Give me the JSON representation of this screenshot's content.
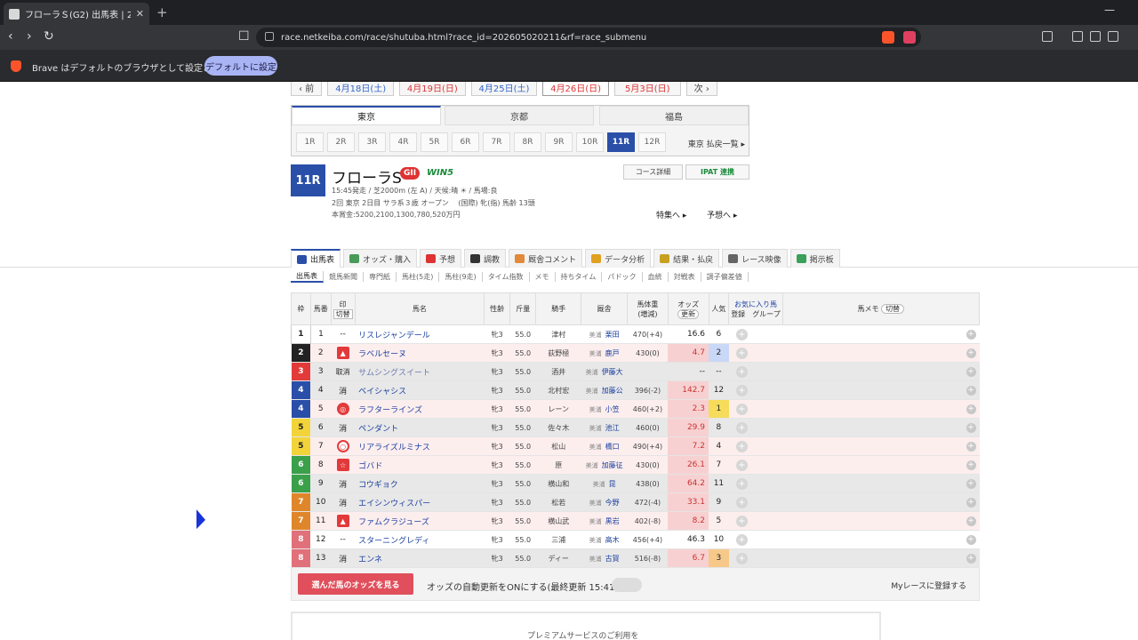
{
  "browser": {
    "tab_title": "フローラＳ(G2) 出馬表 | 2026年4月",
    "url": "race.netkeiba.com/race/shutuba.html?race_id=202605020211&rf=race_submenu",
    "infobar_message": "Brave はデフォルトのブラウザとして設定されていません",
    "infobar_button": "デフォルトに設定"
  },
  "dates": {
    "prev": "‹ 前",
    "next": "次 ›",
    "items": [
      {
        "label": "4月18日(土)",
        "kind": "sat"
      },
      {
        "label": "4月19日(日)",
        "kind": "sun"
      },
      {
        "label": "4月25日(土)",
        "kind": "sat"
      },
      {
        "label": "4月26日(日)",
        "kind": "sun",
        "active": true
      },
      {
        "label": "5月3日(日)",
        "kind": "sun"
      }
    ]
  },
  "venues": [
    "東京",
    "京都",
    "福島"
  ],
  "races": [
    "1R",
    "2R",
    "3R",
    "4R",
    "5R",
    "6R",
    "7R",
    "8R",
    "9R",
    "10R",
    "11R",
    "12R"
  ],
  "race_list_link": "東京 払戻一覧 ▸",
  "race": {
    "number": "11R",
    "name": "フローラS",
    "grade": "GII",
    "win5": "WIN5",
    "line1": "15:45発走 / 芝2000m (左 A) / 天候:晴 ☀ / 馬場:良",
    "line2": "2回 東京 2日目 サラ系３歳 オープン 　(国際) 牝(指) 馬齢 13頭",
    "line3": "本賞金:5200,2100,1300,780,520万円",
    "course_btn": "コース詳細",
    "ipat_btn": "IPAT 連携",
    "tokushu": "特集へ ▸",
    "yoso": "予想へ ▸"
  },
  "main_tabs": [
    {
      "label": "出馬表",
      "color": "#2a4fa8",
      "active": true
    },
    {
      "label": "オッズ・購入",
      "color": "#4a9a5a"
    },
    {
      "label": "予想",
      "color": "#d33"
    },
    {
      "label": "調教",
      "color": "#333"
    },
    {
      "label": "厩舎コメント",
      "color": "#e08a3a"
    },
    {
      "label": "データ分析",
      "color": "#e0a020"
    },
    {
      "label": "結果・払戻",
      "color": "#c8a020"
    },
    {
      "label": "レース映像",
      "color": "#666"
    },
    {
      "label": "掲示板",
      "color": "#3aa05a"
    }
  ],
  "sub_nav": [
    "出馬表",
    "競馬新聞",
    "専門紙",
    "馬柱(5走)",
    "馬柱(9走)",
    "タイム指数",
    "メモ",
    "持ちタイム",
    "パドック",
    "血統",
    "対戦表",
    "調子偏差値"
  ],
  "headers": {
    "waku": "枠",
    "umaban": "馬番",
    "mark": "印",
    "mark_sub": "切替",
    "name": "馬名",
    "sexage": "性齢",
    "weight": "斤量",
    "jockey": "騎手",
    "trainer": "厩舎",
    "body": "馬体重",
    "body_sub": "(増減)",
    "odds": "オッズ",
    "odds_sub": "更新",
    "pop": "人気",
    "fav": "お気に入り馬",
    "fav_reg": "登録",
    "fav_group": "グループ",
    "memo": "馬メモ",
    "memo_btn": "切替"
  },
  "horses": [
    {
      "waku": "1",
      "wc": "#ffffff",
      "wt": "#222",
      "num": "1",
      "mark": "--",
      "mk": "none",
      "name": "リスレジャンデール",
      "sa": "牝3",
      "kg": "55.0",
      "jockey": "津村",
      "area": "美浦",
      "trainer": "栗田",
      "body": "470(+4)",
      "odds": "16.6",
      "pop": "6",
      "row": "",
      "hot": false,
      "ph": ""
    },
    {
      "waku": "2",
      "wc": "#222222",
      "wt": "#fff",
      "num": "2",
      "mark": "▲",
      "mk": "tri",
      "name": "ラベルセーヌ",
      "sa": "牝3",
      "kg": "55.0",
      "jockey": "荻野極",
      "area": "美浦",
      "trainer": "鹿戸",
      "body": "430(0)",
      "odds": "4.7",
      "pop": "2",
      "row": "pink",
      "hot": true,
      "ph": "hl2"
    },
    {
      "waku": "3",
      "wc": "#e23a3a",
      "wt": "#fff",
      "num": "3",
      "mark": "取消",
      "mk": "none",
      "name": "サムシングスイート",
      "sa": "牝3",
      "kg": "55.0",
      "jockey": "酒井",
      "area": "美浦",
      "trainer": "伊藤大",
      "body": "",
      "odds": "--",
      "pop": "--",
      "row": "gray",
      "hot": false,
      "ph": ""
    },
    {
      "waku": "4",
      "wc": "#2a4fa8",
      "wt": "#fff",
      "num": "4",
      "mark": "消",
      "mk": "none",
      "name": "ベイシャシス",
      "sa": "牝3",
      "kg": "55.0",
      "jockey": "北村宏",
      "area": "美浦",
      "trainer": "加藤公",
      "body": "396(-2)",
      "odds": "142.7",
      "pop": "12",
      "row": "gray",
      "hot": true,
      "ph": ""
    },
    {
      "waku": "4",
      "wc": "#2a4fa8",
      "wt": "#fff",
      "num": "5",
      "mark": "◎",
      "mk": "dbl",
      "name": "ラフターラインズ",
      "sa": "牝3",
      "kg": "55.0",
      "jockey": "レーン",
      "area": "美浦",
      "trainer": "小笠",
      "body": "460(+2)",
      "odds": "2.3",
      "pop": "1",
      "row": "pink",
      "hot": true,
      "ph": "hl1"
    },
    {
      "waku": "5",
      "wc": "#f2d43a",
      "wt": "#222",
      "num": "6",
      "mark": "消",
      "mk": "none",
      "name": "ペンダント",
      "sa": "牝3",
      "kg": "55.0",
      "jockey": "佐々木",
      "area": "美浦",
      "trainer": "池江",
      "body": "460(0)",
      "odds": "29.9",
      "pop": "8",
      "row": "gray",
      "hot": true,
      "ph": ""
    },
    {
      "waku": "5",
      "wc": "#f2d43a",
      "wt": "#222",
      "num": "7",
      "mark": "○",
      "mk": "cir",
      "name": "リアライズルミナス",
      "sa": "牝3",
      "kg": "55.0",
      "jockey": "松山",
      "area": "美浦",
      "trainer": "橋口",
      "body": "490(+4)",
      "odds": "7.2",
      "pop": "4",
      "row": "pink",
      "hot": true,
      "ph": ""
    },
    {
      "waku": "6",
      "wc": "#3aa04a",
      "wt": "#fff",
      "num": "8",
      "mark": "☆",
      "mk": "star",
      "name": "ゴバド",
      "sa": "牝3",
      "kg": "55.0",
      "jockey": "原",
      "area": "美浦",
      "trainer": "加藤征",
      "body": "430(0)",
      "odds": "26.1",
      "pop": "7",
      "row": "pink",
      "hot": true,
      "ph": ""
    },
    {
      "waku": "6",
      "wc": "#3aa04a",
      "wt": "#fff",
      "num": "9",
      "mark": "消",
      "mk": "none",
      "name": "コウギョク",
      "sa": "牝3",
      "kg": "55.0",
      "jockey": "横山和",
      "area": "美浦",
      "trainer": "昆",
      "body": "438(0)",
      "odds": "64.2",
      "pop": "11",
      "row": "gray",
      "hot": true,
      "ph": ""
    },
    {
      "waku": "7",
      "wc": "#e0862a",
      "wt": "#fff",
      "num": "10",
      "mark": "消",
      "mk": "none",
      "name": "エイシンウィスパー",
      "sa": "牝3",
      "kg": "55.0",
      "jockey": "松若",
      "area": "美浦",
      "trainer": "今野",
      "body": "472(-4)",
      "odds": "33.1",
      "pop": "9",
      "row": "gray",
      "hot": true,
      "ph": ""
    },
    {
      "waku": "7",
      "wc": "#e0862a",
      "wt": "#fff",
      "num": "11",
      "mark": "▲",
      "mk": "tri",
      "name": "ファムクラジューズ",
      "sa": "牝3",
      "kg": "55.0",
      "jockey": "横山武",
      "area": "美浦",
      "trainer": "黒岩",
      "body": "402(-8)",
      "odds": "8.2",
      "pop": "5",
      "row": "pink",
      "hot": true,
      "ph": ""
    },
    {
      "waku": "8",
      "wc": "#e0707a",
      "wt": "#fff",
      "num": "12",
      "mark": "--",
      "mk": "none",
      "name": "スターニングレディ",
      "sa": "牝3",
      "kg": "55.0",
      "jockey": "三浦",
      "area": "美浦",
      "trainer": "高木",
      "body": "456(+4)",
      "odds": "46.3",
      "pop": "10",
      "row": "",
      "hot": false,
      "ph": ""
    },
    {
      "waku": "8",
      "wc": "#e0707a",
      "wt": "#fff",
      "num": "13",
      "mark": "消",
      "mk": "none",
      "name": "エンネ",
      "sa": "牝3",
      "kg": "55.0",
      "jockey": "ディー",
      "area": "美浦",
      "trainer": "古賀",
      "body": "516(-8)",
      "odds": "6.7",
      "pop": "3",
      "row": "gray",
      "hot": true,
      "ph": "hl3"
    }
  ],
  "footer": {
    "odds_button": "選んだ馬のオッズを見る",
    "auto_update": "オッズの自動更新をONにする(最終更新 15:41)",
    "my_race": "Myレースに登録する"
  },
  "bottom_box": "プレミアムサービスのご利用を"
}
